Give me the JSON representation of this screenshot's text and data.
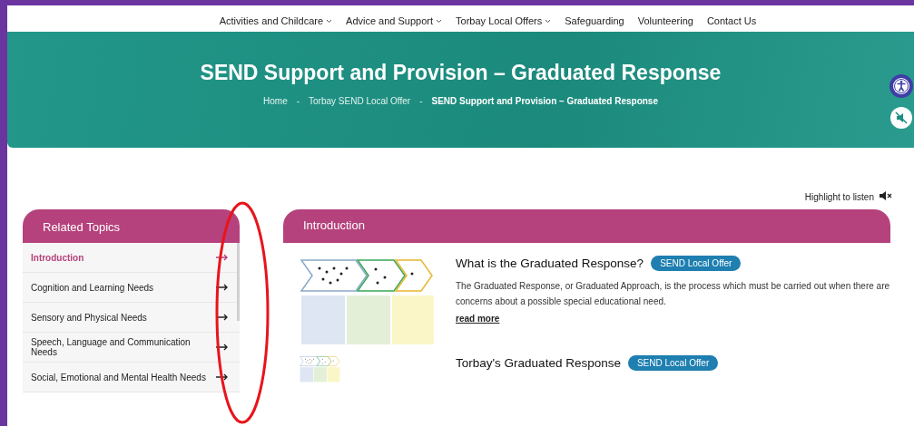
{
  "nav": [
    {
      "label": "Activities and Childcare",
      "has_dropdown": true
    },
    {
      "label": "Advice and Support",
      "has_dropdown": true
    },
    {
      "label": "Torbay Local Offers",
      "has_dropdown": true
    },
    {
      "label": "Safeguarding",
      "has_dropdown": false
    },
    {
      "label": "Volunteering",
      "has_dropdown": false
    },
    {
      "label": "Contact Us",
      "has_dropdown": false
    }
  ],
  "hero": {
    "title": "SEND Support and Provision – Graduated Response",
    "breadcrumb": [
      {
        "label": "Home",
        "current": false
      },
      {
        "label": "Torbay SEND Local Offer",
        "current": false
      },
      {
        "label": "SEND Support and Provision – Graduated Response",
        "current": true
      }
    ],
    "separator": "-"
  },
  "side_tools": [
    {
      "kind": "accessibility"
    },
    {
      "kind": "mute"
    }
  ],
  "listen": {
    "label": "Highlight to listen"
  },
  "sidebar": {
    "title": "Related Topics",
    "items": [
      {
        "label": "Introduction",
        "selected": true
      },
      {
        "label": "Cognition and Learning Needs",
        "selected": false
      },
      {
        "label": "Sensory and Physical Needs",
        "selected": false
      },
      {
        "label": "Speech, Language and Communication Needs",
        "selected": false
      },
      {
        "label": "Social, Emotional and Mental Health Needs",
        "selected": false
      }
    ]
  },
  "main": {
    "title": "Introduction",
    "articles": [
      {
        "title": "What is the Graduated Response?",
        "tag": "SEND Local Offer",
        "description": "The Graduated Response, or Graduated Approach, is the process which must be carried out when there are concerns about a possible special educational need.",
        "link": "read more"
      },
      {
        "title": "Torbay's Graduated Response",
        "tag": "SEND Local Offer"
      }
    ]
  },
  "annotation": {
    "kind": "ellipse"
  }
}
